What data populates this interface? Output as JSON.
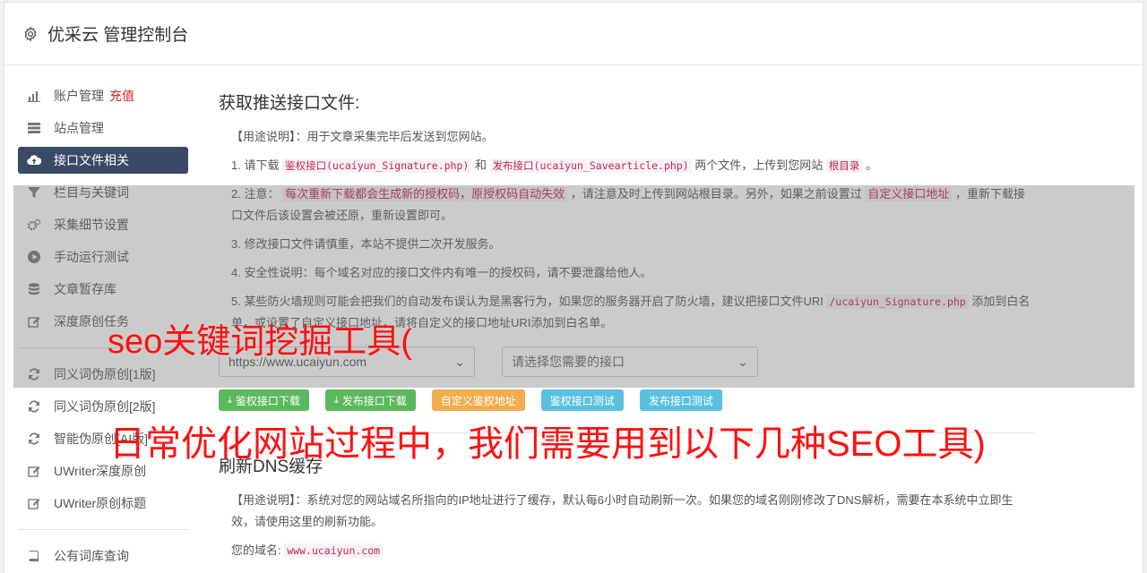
{
  "header": {
    "title": "优采云 管理控制台"
  },
  "sidebar": {
    "items": [
      {
        "label": "账户管理",
        "extra": "充值",
        "icon": "bar-chart-icon"
      },
      {
        "label": "站点管理",
        "icon": "list-icon"
      },
      {
        "label": "接口文件相关",
        "icon": "cloud-upload-icon",
        "active": true
      },
      {
        "label": "栏目与关键词",
        "icon": "filter-icon"
      },
      {
        "label": "采集细节设置",
        "icon": "cogs-icon"
      },
      {
        "label": "手动运行测试",
        "icon": "play-circle-icon"
      },
      {
        "label": "文章暂存库",
        "icon": "database-icon"
      },
      {
        "label": "深度原创任务",
        "icon": "edit-icon"
      },
      {
        "label": "同义词伪原创[1版]",
        "icon": "refresh-icon"
      },
      {
        "label": "同义词伪原创[2版]",
        "icon": "refresh-icon"
      },
      {
        "label": "智能伪原创[AI版]",
        "icon": "refresh-icon"
      },
      {
        "label": "UWriter深度原创",
        "icon": "edit-icon"
      },
      {
        "label": "UWriter原创标题",
        "icon": "edit-icon"
      },
      {
        "label": "公有词库查询",
        "icon": "book-icon"
      }
    ]
  },
  "section1": {
    "title": "获取推送接口文件:",
    "usage": "【用途说明】：用于文章采集完毕后发送到您网站。",
    "p1_a": "1. 请下载 ",
    "p1_link1": "鉴权接口(ucaiyun_Signature.php)",
    "p1_b": " 和 ",
    "p1_link2": "发布接口(ucaiyun_Savearticle.php)",
    "p1_c": " 两个文件，上传到您网站 ",
    "p1_link3": "根目录",
    "p1_d": " 。",
    "p2_a": "2. 注意： ",
    "p2_hl": "每次重新下载都会生成新的授权码，原授权码自动失效",
    "p2_b": " ，请注意及时上传到网站根目录。另外，如果之前设置过 ",
    "p2_hl2": "自定义接口地址",
    "p2_c": " ，重新下载接口文件后该设置会被还原，重新设置即可。",
    "p3": "3. 修改接口文件请慎重，本站不提供二次开发服务。",
    "p4": "4. 安全性说明：每个域名对应的接口文件内有唯一的授权码，请不要泄露给他人。",
    "p5_a": "5. 某些防火墙规则可能会把我们的自动发布误认为是黑客行为，如果您的服务器开启了防火墙，建议把接口文件URI ",
    "p5_code": "/ucaiyun_Signature.php",
    "p5_b": " 添加到白名单，或设置了自定义接口地址，请将自定义的接口地址URI添加到白名单。",
    "select_site": "https://www.ucaiyun.com",
    "select_api": "请选择您需要的接口",
    "buttons": {
      "download_sign": "鉴权接口下载",
      "download_publish": "发布接口下载",
      "custom_sign": "自定义鉴权地址",
      "test_sign": "鉴权接口测试",
      "test_publish": "发布接口测试"
    }
  },
  "section2": {
    "title": "刷新DNS缓存",
    "usage": "【用途说明】：系统对您的网站域名所指向的IP地址进行了缓存，默认每6小时自动刷新一次。如果您的域名刚刚修改了DNS解析，需要在本系统中立即生效，请使用这里的刷新功能。",
    "domain_label": "您的域名:",
    "domain_value": "www.ucaiyun.com"
  },
  "watermark": {
    "line1": "seo关键词挖掘工具(",
    "line2": "日常优化网站过程中，我们需要用到以下几种SEO工具)"
  },
  "colors": {
    "sidebar_active": "#3a4a66",
    "watermark": "#ff1010",
    "green": "#5cb85c",
    "orange": "#f0ad4e",
    "blue": "#5bc0de"
  }
}
